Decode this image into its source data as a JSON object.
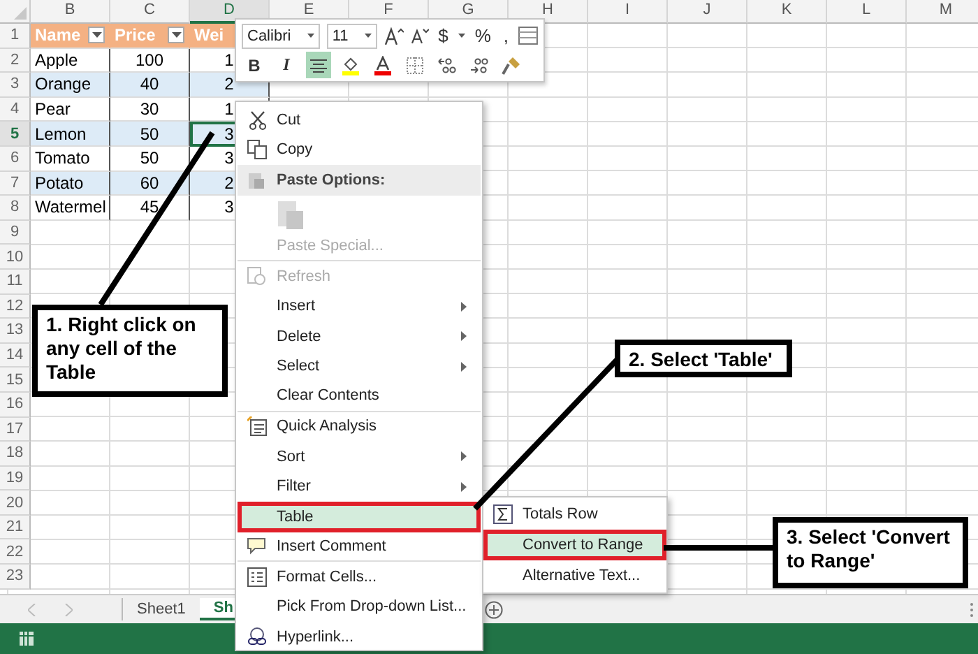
{
  "columns": [
    {
      "label": "B",
      "selected": false
    },
    {
      "label": "C",
      "selected": false
    },
    {
      "label": "D",
      "selected": true
    },
    {
      "label": "E",
      "selected": false
    },
    {
      "label": "F",
      "selected": false
    },
    {
      "label": "G",
      "selected": false
    },
    {
      "label": "H",
      "selected": false
    },
    {
      "label": "I",
      "selected": false
    },
    {
      "label": "J",
      "selected": false
    },
    {
      "label": "K",
      "selected": false
    },
    {
      "label": "L",
      "selected": false
    },
    {
      "label": "M",
      "selected": false
    }
  ],
  "rows": [
    {
      "label": "1",
      "selected": false
    },
    {
      "label": "2",
      "selected": false
    },
    {
      "label": "3",
      "selected": false
    },
    {
      "label": "4",
      "selected": false
    },
    {
      "label": "5",
      "selected": true
    },
    {
      "label": "6",
      "selected": false
    },
    {
      "label": "7",
      "selected": false
    },
    {
      "label": "8",
      "selected": false
    },
    {
      "label": "9",
      "selected": false
    },
    {
      "label": "10",
      "selected": false
    },
    {
      "label": "11",
      "selected": false
    },
    {
      "label": "12",
      "selected": false
    },
    {
      "label": "13",
      "selected": false
    },
    {
      "label": "14",
      "selected": false
    },
    {
      "label": "15",
      "selected": false
    },
    {
      "label": "16",
      "selected": false
    },
    {
      "label": "17",
      "selected": false
    },
    {
      "label": "18",
      "selected": false
    },
    {
      "label": "19",
      "selected": false
    },
    {
      "label": "20",
      "selected": false
    },
    {
      "label": "21",
      "selected": false
    },
    {
      "label": "22",
      "selected": false
    },
    {
      "label": "23",
      "selected": false
    }
  ],
  "table": {
    "headers": [
      {
        "text": "Name",
        "filter": true
      },
      {
        "text": "Price",
        "filter": true
      },
      {
        "text": "Wei"
      }
    ],
    "rows": [
      {
        "cells": [
          "Apple",
          "100",
          "1"
        ],
        "active": false
      },
      {
        "cells": [
          "Orange",
          "40",
          "2"
        ],
        "active": false
      },
      {
        "cells": [
          "Pear",
          "30",
          "1"
        ],
        "active": false
      },
      {
        "cells": [
          "Lemon",
          "50",
          "3"
        ],
        "active": true
      },
      {
        "cells": [
          "Tomato",
          "50",
          "3"
        ],
        "active": false
      },
      {
        "cells": [
          "Potato",
          "60",
          "2"
        ],
        "active": false
      },
      {
        "cells": [
          "Watermel",
          "45",
          "3"
        ],
        "active": false
      }
    ]
  },
  "mini_toolbar": {
    "font": "Calibri",
    "size": "11",
    "currency": "$",
    "percent": "%",
    "comma": ",",
    "format_buttons": [
      {
        "kind": "text",
        "label": "B",
        "selected": false
      },
      {
        "kind": "text",
        "label": "I",
        "selected": false
      },
      {
        "kind": "align",
        "selected": true
      },
      {
        "kind": "fill",
        "selected": false
      },
      {
        "kind": "fontcolor",
        "selected": false
      },
      {
        "kind": "borders",
        "selected": false
      },
      {
        "kind": "incdec",
        "selected": false
      },
      {
        "kind": "decdec",
        "selected": false
      },
      {
        "kind": "painter",
        "selected": false
      }
    ]
  },
  "context_menu": {
    "items": [
      {
        "kind": "item",
        "label": "Cut",
        "disabled": false,
        "submenu": false,
        "selected": false,
        "separator": false
      },
      {
        "kind": "item",
        "label": "Copy",
        "disabled": false,
        "submenu": false,
        "selected": false,
        "separator": false
      },
      {
        "kind": "header",
        "label": "Paste Options:"
      },
      {
        "kind": "paste-option",
        "disabled": true
      },
      {
        "kind": "item",
        "label": "Paste Special...",
        "disabled": true,
        "submenu": false,
        "selected": false,
        "separator": true
      },
      {
        "kind": "item",
        "label": "Refresh",
        "disabled": true,
        "submenu": false,
        "selected": false,
        "separator": false
      },
      {
        "kind": "item",
        "label": "Insert",
        "disabled": false,
        "submenu": true,
        "selected": false,
        "separator": false
      },
      {
        "kind": "item",
        "label": "Delete",
        "disabled": false,
        "submenu": true,
        "selected": false,
        "separator": false
      },
      {
        "kind": "item",
        "label": "Select",
        "disabled": false,
        "submenu": true,
        "selected": false,
        "separator": false
      },
      {
        "kind": "item",
        "label": "Clear Contents",
        "disabled": false,
        "submenu": false,
        "selected": false,
        "separator": true
      },
      {
        "kind": "item",
        "label": "Quick Analysis",
        "disabled": false,
        "submenu": false,
        "selected": false,
        "separator": false
      },
      {
        "kind": "item",
        "label": "Sort",
        "disabled": false,
        "submenu": true,
        "selected": false,
        "separator": false
      },
      {
        "kind": "item",
        "label": "Filter",
        "disabled": false,
        "submenu": true,
        "selected": false,
        "separator": false
      },
      {
        "kind": "item",
        "label": "Table",
        "disabled": false,
        "submenu": false,
        "selected": true,
        "separator": false
      },
      {
        "kind": "item",
        "label": "Insert Comment",
        "disabled": false,
        "submenu": false,
        "selected": false,
        "separator": true
      },
      {
        "kind": "item",
        "label": "Format Cells...",
        "disabled": false,
        "submenu": false,
        "selected": false,
        "separator": false
      },
      {
        "kind": "item",
        "label": "Pick From Drop-down List...",
        "disabled": false,
        "submenu": false,
        "selected": false,
        "separator": false
      },
      {
        "kind": "item",
        "label": "Hyperlink...",
        "disabled": false,
        "submenu": false,
        "selected": false,
        "separator": false
      }
    ]
  },
  "submenu": {
    "items": [
      {
        "label": "Totals Row",
        "selected": false
      },
      {
        "label": "Convert to Range",
        "selected": true
      },
      {
        "label": "Alternative Text...",
        "selected": false
      }
    ]
  },
  "callouts": [
    {
      "text": "1. Right click on any cell of the Table"
    },
    {
      "text": "2. Select 'Table'"
    },
    {
      "text": "3. Select 'Convert to Range'"
    }
  ],
  "sheet_tabs": [
    {
      "label": "Sheet1",
      "selected": false
    },
    {
      "label": "Sh",
      "selected": true
    }
  ]
}
